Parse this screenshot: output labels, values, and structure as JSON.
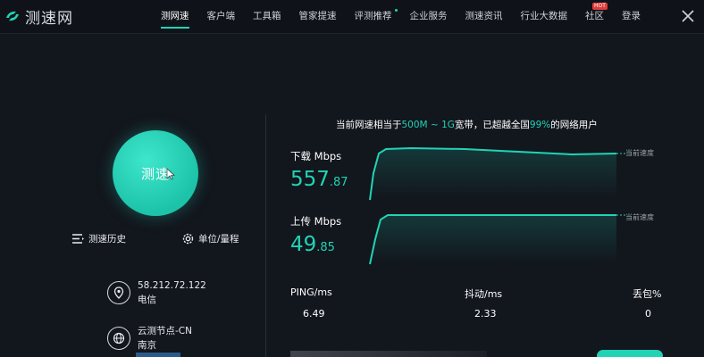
{
  "app": {
    "logo_text": "测速网"
  },
  "nav": {
    "items": [
      {
        "label": "测网速",
        "active": true
      },
      {
        "label": "客户端"
      },
      {
        "label": "工具箱"
      },
      {
        "label": "管家提速"
      },
      {
        "label": "评测推荐"
      },
      {
        "label": "企业服务"
      },
      {
        "label": "测速资讯"
      },
      {
        "label": "行业大数据"
      },
      {
        "label": "社区",
        "badge": "HOT"
      },
      {
        "label": "登录"
      }
    ]
  },
  "left": {
    "start_label": "测速",
    "history_label": "测速历史",
    "units_label": "单位/量程",
    "ip": "58.212.72.122",
    "isp": "电信",
    "node": "云测节点-CN",
    "city": "南京"
  },
  "right": {
    "headline_prefix": "当前网速相当于",
    "headline_bandwidth": "500M ~ 1G",
    "headline_mid": "宽带，已超越全国",
    "headline_percent": "99%",
    "headline_suffix": "的网络用户",
    "download": {
      "label": "下载 Mbps",
      "int": "557",
      "dec": ".87",
      "current_label": "当前速度"
    },
    "upload": {
      "label": "上传 Mbps",
      "int": "49",
      "dec": ".85",
      "current_label": "当前速度"
    },
    "ping": {
      "label": "PING/ms",
      "value": "6.49"
    },
    "jitter": {
      "label": "抖动/ms",
      "value": "2.33"
    },
    "loss": {
      "label": "丢包%",
      "value": "0"
    }
  },
  "colors": {
    "accent": "#21d3b5",
    "background": "#12161d",
    "hot": "#e23b3b"
  }
}
